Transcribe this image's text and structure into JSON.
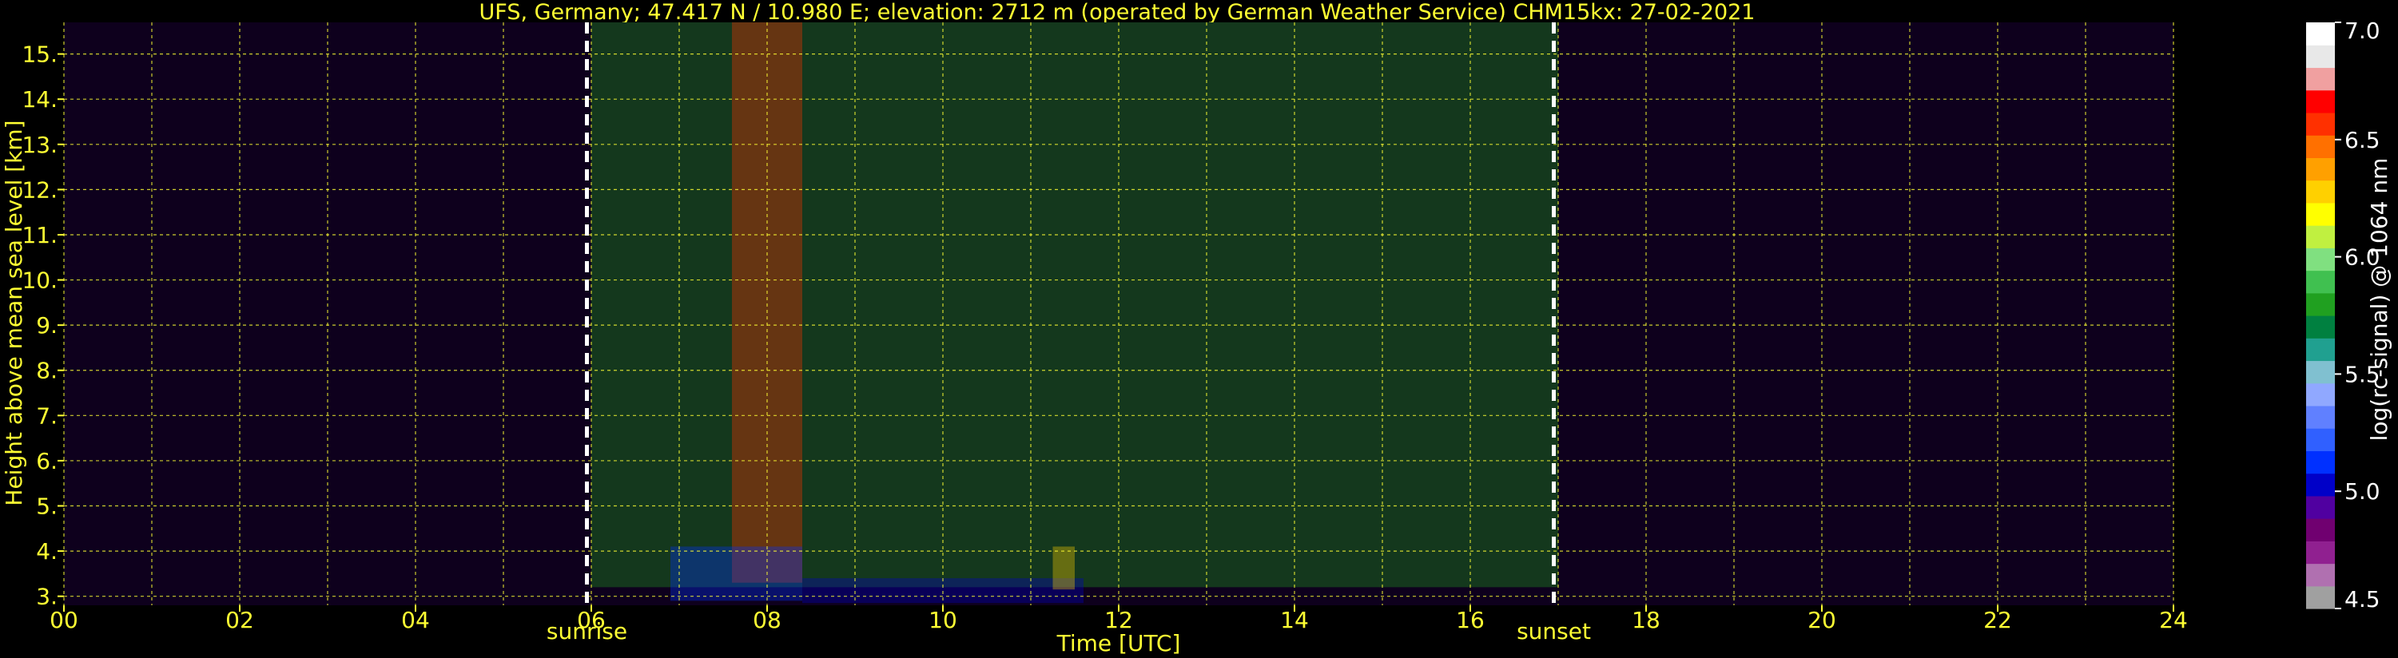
{
  "title": "UFS, Germany; 47.417 N / 10.980 E; elevation: 2712 m  (operated by German Weather Service)     CHM15kx: 27-02-2021",
  "colors": {
    "background": "#000000",
    "text": "#ffff33",
    "grid": "#ffff33",
    "marker": "#ffffff"
  },
  "chart_data": {
    "type": "heatmap",
    "title": "UFS, Germany; 47.417 N / 10.980 E; elevation: 2712 m  (operated by German Weather Service)     CHM15kx: 27-02-2021",
    "xlabel": "Time [UTC]",
    "ylabel": "Height above mean sea level [km]",
    "xlim": [
      0,
      24
    ],
    "ylim": [
      2.8,
      15.7
    ],
    "x_ticks": [
      0,
      2,
      4,
      6,
      8,
      10,
      12,
      14,
      16,
      18,
      20,
      22,
      24
    ],
    "x_tick_labels": [
      "00",
      "02",
      "04",
      "06",
      "08",
      "10",
      "12",
      "14",
      "16",
      "18",
      "20",
      "22",
      "24"
    ],
    "x_minor_step": 1,
    "y_ticks": [
      3,
      4,
      5,
      6,
      7,
      8,
      9,
      10,
      11,
      12,
      13,
      14,
      15
    ],
    "y_tick_labels": [
      "3.",
      "4.",
      "5.",
      "6.",
      "7.",
      "8.",
      "9.",
      "10.",
      "11.",
      "12.",
      "13.",
      "14.",
      "15."
    ],
    "grid": true,
    "markers": [
      {
        "label": "sunrise",
        "x": 5.95
      },
      {
        "label": "sunset",
        "x": 16.95
      }
    ],
    "colorbar": {
      "label": "log(rc-signal) @ 1064 nm",
      "range": [
        4.5,
        7.0
      ],
      "ticks": [
        4.5,
        5.0,
        5.5,
        6.0,
        6.5,
        7.0
      ],
      "tick_labels": [
        "4.5",
        "5.0",
        "5.5",
        "6.0",
        "6.5",
        "7.0"
      ],
      "colors": [
        "#a0a0a0",
        "#b070b0",
        "#902090",
        "#700070",
        "#5000a0",
        "#0000c8",
        "#0030ff",
        "#3060ff",
        "#6080ff",
        "#90a8ff",
        "#80c0d0",
        "#20a090",
        "#008040",
        "#20a020",
        "#40c050",
        "#80e080",
        "#c0f040",
        "#ffff00",
        "#ffd000",
        "#ffa000",
        "#ff7000",
        "#ff3000",
        "#ff0000",
        "#f0a0a0",
        "#e8e8e8",
        "#ffffff"
      ]
    },
    "features": [
      {
        "name": "night noise",
        "x": [
          0,
          24
        ],
        "y": [
          2.8,
          15.7
        ],
        "level": 4.9
      },
      {
        "name": "daytime background",
        "x": [
          6,
          17
        ],
        "y": [
          3.2,
          15.7
        ],
        "level": 5.8
      },
      {
        "name": "high-signal column",
        "x": [
          7.6,
          8.4
        ],
        "y": [
          3.3,
          15.7
        ],
        "level": 6.6
      },
      {
        "name": "boundary layer",
        "x": [
          6.9,
          8.4
        ],
        "y": [
          2.9,
          4.1
        ],
        "level": 5.1
      },
      {
        "name": "near-surface layer",
        "x": [
          8.4,
          11.6
        ],
        "y": [
          2.85,
          3.4
        ],
        "level": 5.0
      },
      {
        "name": "cloud",
        "x": [
          11.25,
          11.5
        ],
        "y": [
          3.15,
          4.1
        ],
        "level": 6.3
      }
    ]
  }
}
